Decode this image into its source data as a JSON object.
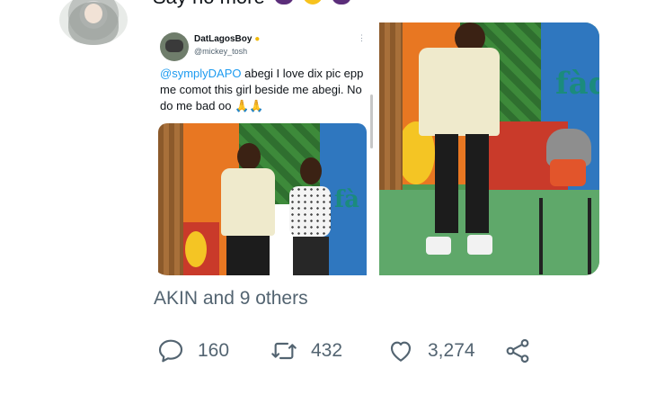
{
  "tweet": {
    "text_partial": "Say no more"
  },
  "quoted": {
    "name": "DatLagosBoy",
    "handle": "@mickey_tosh",
    "more": "⋮",
    "mention": "@symplyDAPO",
    "body": " abegi I love dix pic epp me comot this girl beside me abegi. No do me bad oo 🙏🙏"
  },
  "liked_by": "AKIN and 9 others",
  "actions": {
    "replies": "160",
    "retweets": "432",
    "likes": "3,274"
  },
  "colors": {
    "accent": "#1d9bf0",
    "muted": "#536471"
  }
}
